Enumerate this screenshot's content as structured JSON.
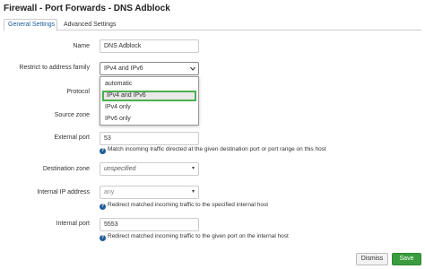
{
  "page": {
    "title": "Firewall - Port Forwards - DNS Adblock"
  },
  "tabs": [
    {
      "label": "General Settings",
      "active": true
    },
    {
      "label": "Advanced Settings",
      "active": false
    }
  ],
  "form": {
    "name": {
      "label": "Name",
      "value": "DNS Adblock"
    },
    "address_family": {
      "label": "Restrict to address family",
      "value": "IPv4 and IPv6",
      "options": [
        "automatic",
        "IPv4 and IPv6",
        "IPv4 only",
        "IPv6 only"
      ],
      "highlighted": "IPv4 and IPv6"
    },
    "protocol": {
      "label": "Protocol"
    },
    "source_zone": {
      "label": "Source zone"
    },
    "external_port": {
      "label": "External port",
      "value": "53",
      "help": "Match incoming traffic directed at the given destination port or port range on this host"
    },
    "destination_zone": {
      "label": "Destination zone",
      "value": "unspecified"
    },
    "internal_ip": {
      "label": "Internal IP address",
      "value": "any",
      "help": "Redirect matched incoming traffic to the specified internal host"
    },
    "internal_port": {
      "label": "Internal port",
      "value": "5553",
      "help": "Redirect matched incoming traffic to the given port on the internal host"
    }
  },
  "buttons": {
    "dismiss": "Dismiss",
    "save": "Save"
  },
  "colors": {
    "accent": "#1f5e99",
    "save": "#3a9c3f",
    "highlight_border": "#4caf50"
  }
}
